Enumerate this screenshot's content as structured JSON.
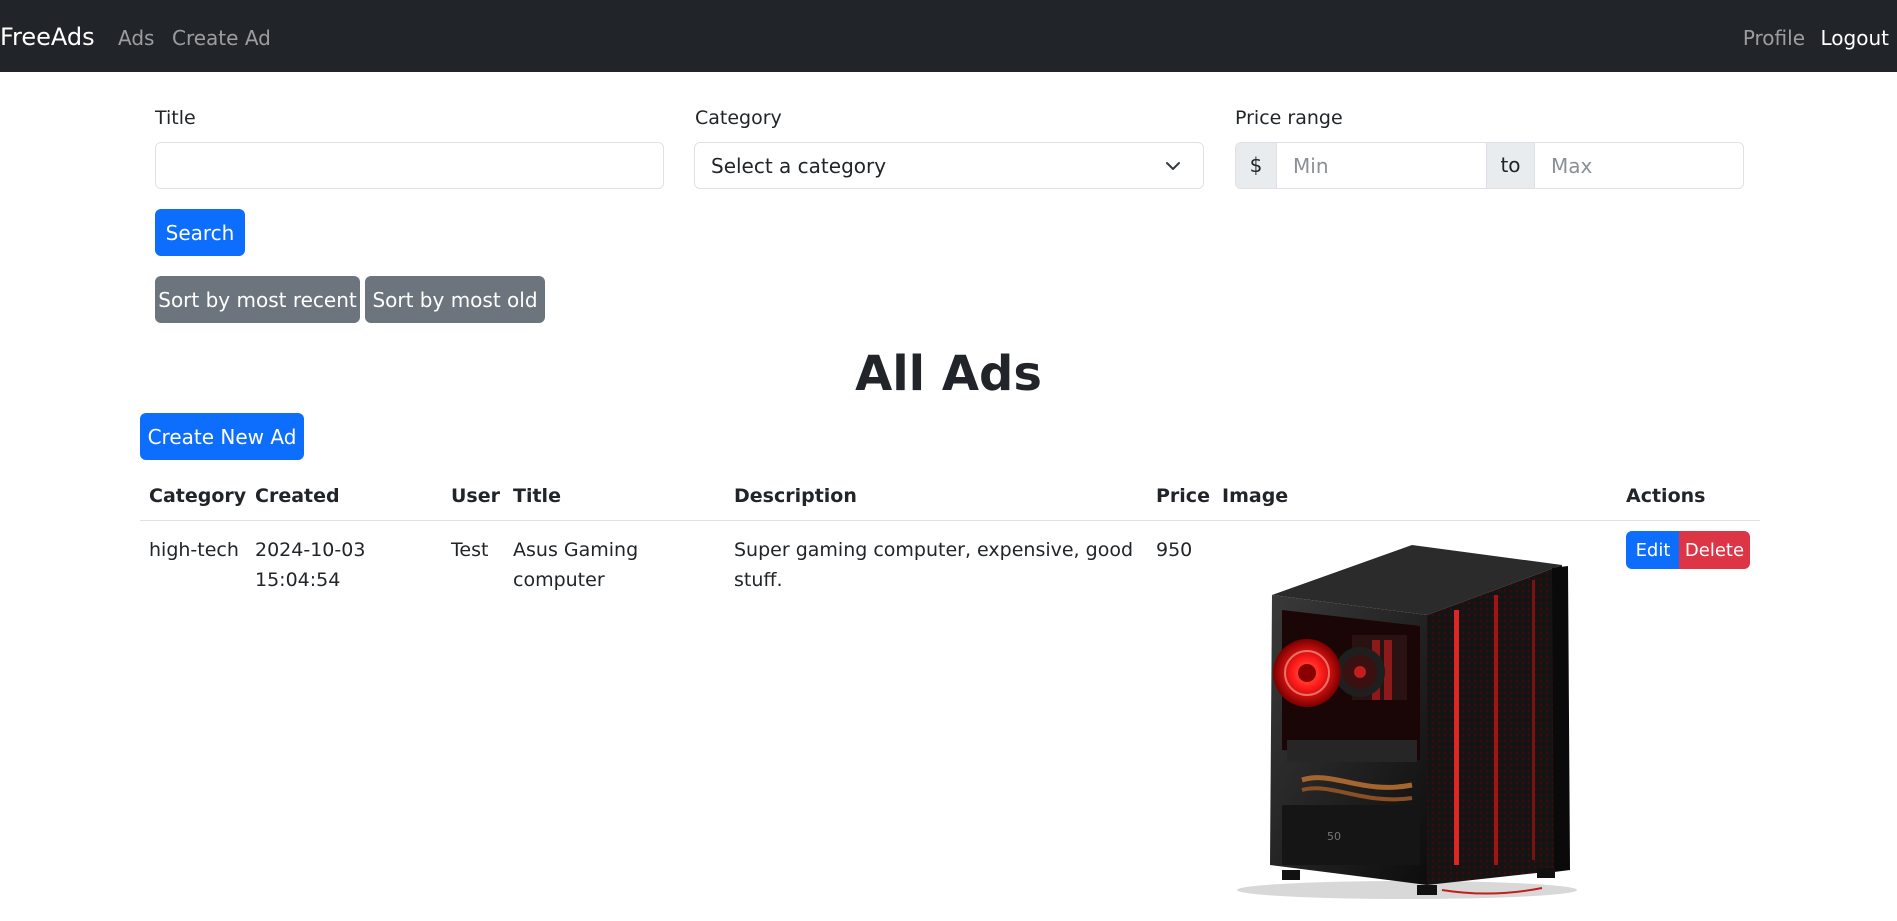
{
  "navbar": {
    "brand": "FreeAds",
    "links": [
      "Ads",
      "Create Ad"
    ],
    "right_links": [
      "Profile",
      "Logout"
    ]
  },
  "filters": {
    "title": {
      "label": "Title",
      "value": ""
    },
    "category": {
      "label": "Category",
      "selected": "Select a category"
    },
    "price": {
      "label": "Price range",
      "currency": "$",
      "min_placeholder": "Min",
      "separator": "to",
      "max_placeholder": "Max"
    },
    "search_button": "Search",
    "sort_buttons": [
      "Sort by most recent",
      "Sort by most old"
    ]
  },
  "page_title": "All Ads",
  "create_button": "Create New Ad",
  "table": {
    "columns": [
      "Category",
      "Created",
      "User",
      "Title",
      "Description",
      "Price",
      "Image",
      "Actions"
    ],
    "rows": [
      {
        "category": "high-tech",
        "created": [
          "2024-10-03",
          "15:04:54"
        ],
        "user": "Test",
        "title": "Asus Gaming computer",
        "description": "Super gaming computer, expensive, good stuff.",
        "price": "950",
        "image": "gaming-pc-case-image",
        "actions": [
          "Edit",
          "Delete"
        ]
      }
    ]
  },
  "colors": {
    "navbar_bg": "#212529",
    "primary": "#0d6efd",
    "secondary": "#6c757d",
    "danger": "#dc3545"
  }
}
